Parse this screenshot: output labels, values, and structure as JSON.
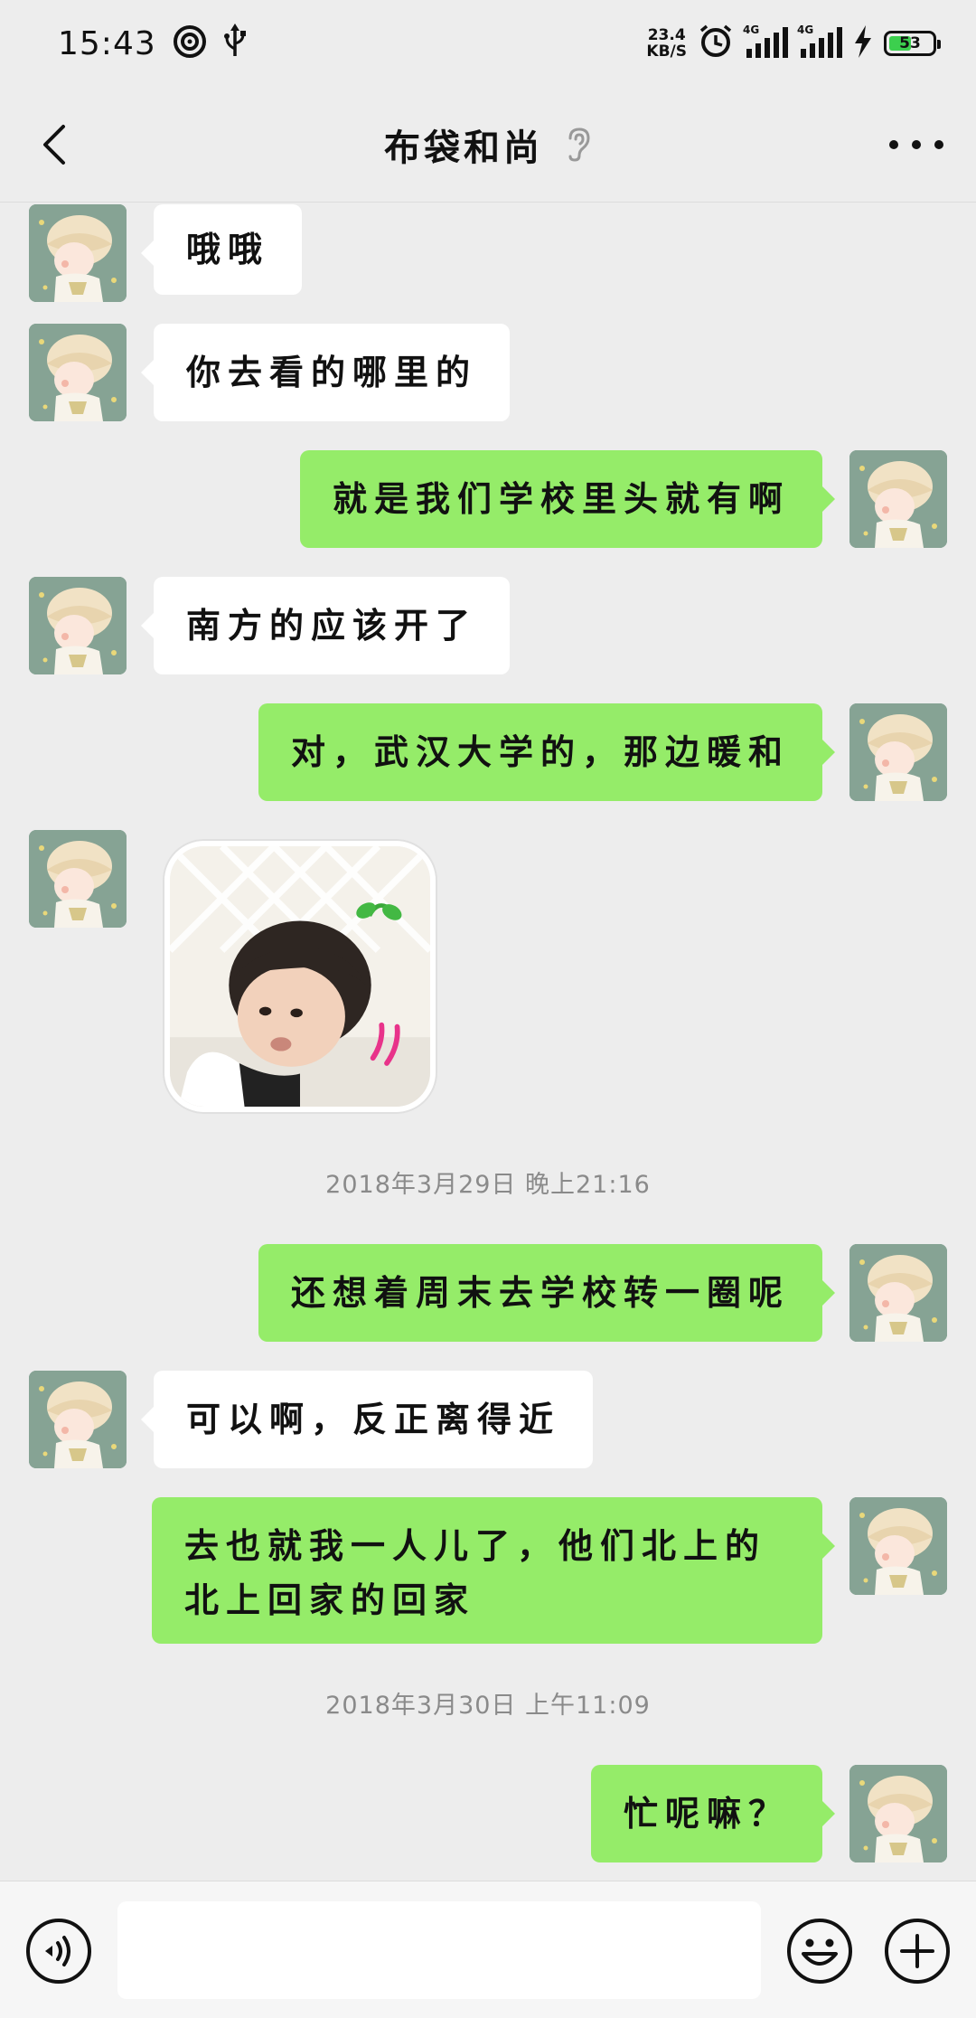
{
  "status_bar": {
    "time": "15:43",
    "net_speed_value": "23.4",
    "net_speed_unit": "KB/S",
    "network_label_1": "4G",
    "network_label_2": "4G",
    "battery_level": "53"
  },
  "header": {
    "title": "布袋和尚"
  },
  "messages": [
    {
      "side": "in",
      "text": "哦哦"
    },
    {
      "side": "in",
      "text": "你去看的哪里的"
    },
    {
      "side": "out",
      "text": "就是我们学校里头就有啊"
    },
    {
      "side": "in",
      "text": "南方的应该开了"
    },
    {
      "side": "out",
      "text": "对，武汉大学的，那边暖和"
    },
    {
      "side": "in",
      "type": "sticker"
    },
    {
      "side": "out",
      "text": "还想着周末去学校转一圈呢"
    },
    {
      "side": "in",
      "text": "可以啊，反正离得近"
    },
    {
      "side": "out",
      "text": "去也就我一人儿了，他们北上的北上回家的回家"
    },
    {
      "side": "out",
      "text": "忙呢嘛？"
    }
  ],
  "timestamps": [
    "2018年3月29日 晚上21:16",
    "2018年3月30日 上午11:09"
  ],
  "input": {
    "value": "",
    "placeholder": ""
  },
  "colors": {
    "background": "#ededed",
    "outgoing_bubble": "#95ec69",
    "incoming_bubble": "#ffffff",
    "timestamp_text": "#8a8a8a"
  },
  "icons": {
    "back": "chevron-left-icon",
    "title_mode": "ear-icon",
    "more": "more-dots-icon",
    "voice": "voice-icon",
    "emoji": "emoji-icon",
    "plus": "plus-icon"
  }
}
